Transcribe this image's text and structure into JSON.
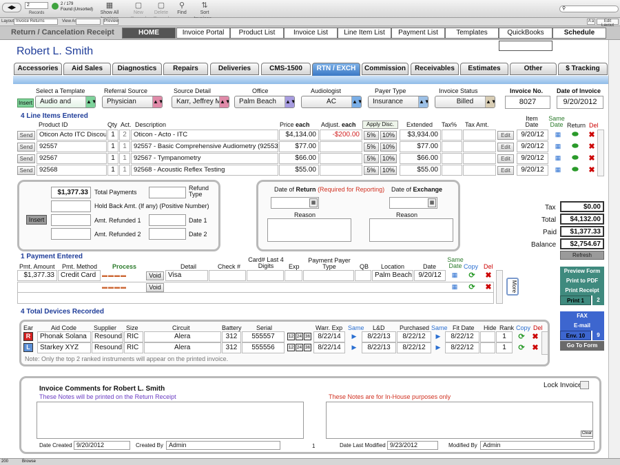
{
  "toolbar": {
    "record_num": "2",
    "records_label": "Records",
    "found_count": "2 / 179",
    "found_label": "Found (Unsorted)",
    "show_all": "Show All Invoices",
    "new_record": "New Record",
    "delete_record": "Delete Record",
    "find": "Find",
    "sort": "Sort Invoices..."
  },
  "layoutbar": {
    "layout_label": "Layout:",
    "layout_value": "Invoice Returns",
    "view_as": "View As:",
    "preview": "Preview",
    "aa": "A a",
    "edit_layout": "Edit Layout"
  },
  "page_title": "Return / Cancelation Receipt",
  "nav": [
    "HOME",
    "Invoice Portal",
    "Product List",
    "Invoice List",
    "Line Item List",
    "Payment List",
    "Templates",
    "QuickBooks",
    "Schedule"
  ],
  "patient_name": "Robert L. Smith",
  "form_tabs": [
    "Accessories",
    "Aid Sales",
    "Diagnostics",
    "Repairs",
    "Deliveries",
    "CMS-1500",
    "RTN / EXCH",
    "Commission",
    "Receivables",
    "Estimates",
    "Other",
    "$ Tracking"
  ],
  "header_fields": {
    "select_template_label": "Select a Template",
    "select_template_value": "Audio and",
    "insert_label": "Insert",
    "referral_source_label": "Referral Source",
    "referral_source_value": "Physician",
    "source_detail_label": "Source Detail",
    "source_detail_value": "Karr, Jeffrey MD",
    "office_label": "Office",
    "office_value": "Palm Beach",
    "audiologist_label": "Audiologist",
    "audiologist_value": "AC",
    "payer_type_label": "Payer Type",
    "payer_type_value": "Insurance",
    "invoice_status_label": "Invoice Status",
    "invoice_status_value": "Billed",
    "invoice_no_label": "Invoice No.",
    "invoice_no_value": "8027",
    "date_of_invoice_label": "Date of Invoice",
    "date_of_invoice_value": "9/20/2012"
  },
  "line_items": {
    "title": "4 Line Items Entered",
    "headers": {
      "product_id": "Product ID",
      "qty": "Qty",
      "act": "Act.",
      "description": "Description",
      "price": "Price",
      "each": "each",
      "adjust": "Adjust.",
      "adjust_each": "each",
      "apply_disc": "Apply Disc.",
      "extended": "Extended",
      "tax_pct": "Tax%",
      "tax_amt": "Tax Amt.",
      "item_date": "Item Date",
      "same_date": "Same Date",
      "return": "Return",
      "del": "Del"
    },
    "send_label": "Send",
    "edit_label": "Edit",
    "pct5": "5%",
    "pct10": "10%",
    "rows": [
      {
        "product_id": "Oticon Acto ITC Discount",
        "qty": "1",
        "act": "2",
        "description": "Oticon - Acto - ITC",
        "price": "$4,134.00",
        "adjust": "-$200.00",
        "extended": "$3,934.00",
        "date": "9/20/12"
      },
      {
        "product_id": "92557",
        "qty": "1",
        "act": "1",
        "description": "92557 - Basic Comprehensive Audiometry (92553 & 92556 Combined)",
        "price": "$77.00",
        "adjust": "",
        "extended": "$77.00",
        "date": "9/20/12"
      },
      {
        "product_id": "92567",
        "qty": "1",
        "act": "1",
        "description": "92567 - Tympanometry",
        "price": "$66.00",
        "adjust": "",
        "extended": "$66.00",
        "date": "9/20/12"
      },
      {
        "product_id": "92568",
        "qty": "1",
        "act": "1",
        "description": "92568 - Acoustic Reflex Testing",
        "price": "$55.00",
        "adjust": "",
        "extended": "$55.00",
        "date": "9/20/12"
      }
    ]
  },
  "refund_panel": {
    "total_payments_value": "$1,377.33",
    "total_payments_label": "Total Payments",
    "refund_type_label": "Refund Type",
    "hold_back_label": "Hold Back Amt. (If any) (Positive Number)",
    "insert_label": "Insert",
    "amt_refunded1_label": "Amt. Refunded 1",
    "date1_label": "Date 1",
    "amt_refunded2_label": "Amt. Refunded 2",
    "date2_label": "Date 2"
  },
  "return_panel": {
    "date_of": "Date of",
    "return_word": "Return",
    "required": "(Required for Reporting)",
    "date_of_exchange": "Date of",
    "exchange_word": "Exchange",
    "reason1": "Reason",
    "reason2": "Reason"
  },
  "totals": {
    "tax_label": "Tax",
    "tax_value": "$0.00",
    "total_label": "Total",
    "total_value": "$4,132.00",
    "paid_label": "Paid",
    "paid_value": "$1,377.33",
    "balance_label": "Balance",
    "balance_value": "$2,754.67",
    "refresh": "Refresh"
  },
  "payments": {
    "title": "1 Payment Entered",
    "headers": {
      "amount": "Pmt. Amount",
      "method": "Pmt. Method",
      "process": "Process",
      "detail": "Detail",
      "check": "Check #",
      "card_last": "Card# Last 4 Digits",
      "exp": "Exp",
      "payer_type": "Payment Payer Type",
      "qb": "QB",
      "location": "Location",
      "date": "Date",
      "same_date": "Same Date",
      "copy": "Copy",
      "del": "Del"
    },
    "void_label": "Void",
    "more_label": "More",
    "rows": [
      {
        "amount": "$1,377.33",
        "method": "Credit Card",
        "detail": "Visa",
        "location": "Palm Beach",
        "date": "9/20/12"
      }
    ]
  },
  "side_buttons": {
    "preview_form": "Preview Form",
    "print_pdf": "Print to PDF",
    "print_receipt": "Print Receipt",
    "print1": "Print 1",
    "print1_count": "2",
    "fax": "FAX",
    "email": "E-mail",
    "env": "Env. 10",
    "env_count": "9",
    "go_to_form": "Go To Form"
  },
  "devices": {
    "title": "4 Total Devices Recorded",
    "headers": {
      "ear": "Ear",
      "aid_code": "Aid Code",
      "supplier": "Supplier",
      "size": "Size",
      "circuit": "Circuit",
      "battery": "Battery",
      "serial": "Serial",
      "warr_exp": "Warr. Exp",
      "same1": "Same",
      "ld": "L&D",
      "purchased": "Purchased",
      "same2": "Same",
      "fit_date": "Fit Date",
      "hide": "Hide",
      "rank": "Rank",
      "copy": "Copy",
      "del": "Del"
    },
    "months": [
      "12",
      "24",
      "36"
    ],
    "rows": [
      {
        "ear": "R",
        "aid_code": "Phonak Solana",
        "supplier": "Resound",
        "size": "RIC",
        "circuit": "Alera",
        "battery": "312",
        "serial": "555557",
        "warr_exp": "8/22/14",
        "ld": "8/22/13",
        "purchased": "8/22/12",
        "fit_date": "8/22/12",
        "rank": "1"
      },
      {
        "ear": "L",
        "aid_code": "Starkey XYZ",
        "supplier": "Resound",
        "size": "RIC",
        "circuit": "Alera",
        "battery": "312",
        "serial": "555556",
        "warr_exp": "8/22/14",
        "ld": "8/22/13",
        "purchased": "8/22/12",
        "fit_date": "8/22/12",
        "rank": "1"
      }
    ],
    "note": "Note: Only the top 2 ranked instruments will appear on the printed invoice."
  },
  "comments": {
    "title": "Invoice Comments for Robert L. Smith",
    "lock_label": "Lock Invoice",
    "printed_note": "These Notes will be printed on the Return Receipt",
    "inhouse_note": "These Notes are for In-House purposes only",
    "clear": "Clear",
    "date_created_label": "Date Created",
    "date_created_value": "9/20/2012",
    "created_by_label": "Created By",
    "created_by_value": "Admin",
    "page_num": "1",
    "date_modified_label": "Date Last Modified",
    "date_modified_value": "9/23/2012",
    "modified_by_label": "Modified By",
    "modified_by_value": "Admin"
  },
  "statusbar": {
    "zoom": "200",
    "mode": "Browse"
  },
  "colors": {
    "accent_blue": "#3a78c5",
    "section_blue": "#1f3d99",
    "adjust_red": "#d02020",
    "green": "#2a9a2a",
    "teal": "#3f8a7e",
    "nav_blue": "#3d66cf"
  }
}
